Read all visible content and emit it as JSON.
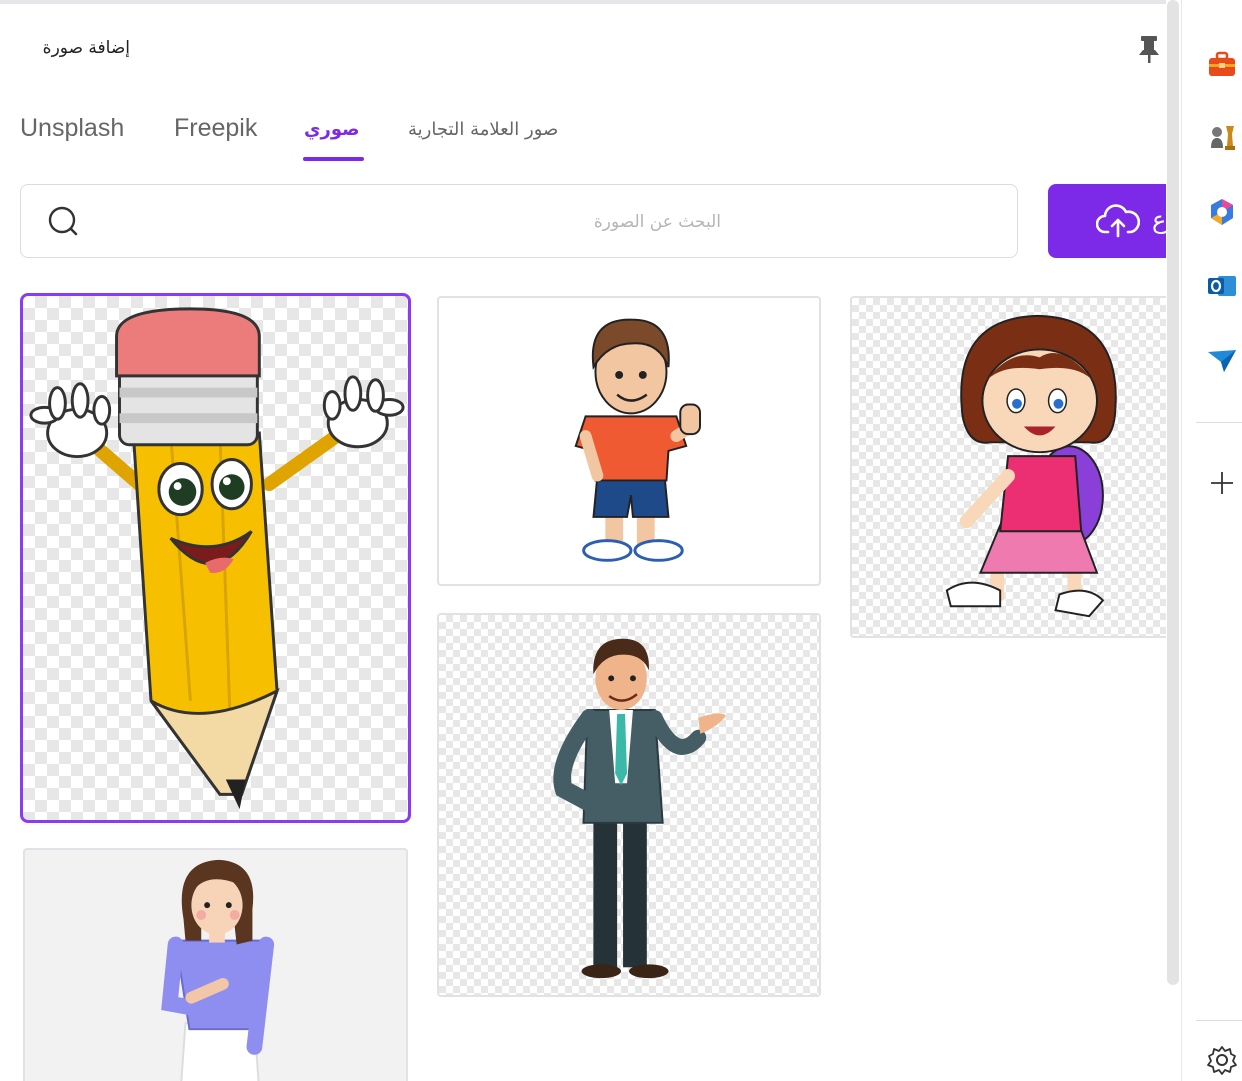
{
  "panel": {
    "title": "إضافة صورة"
  },
  "tabs": [
    {
      "label": "Unsplash"
    },
    {
      "label": "Freepik"
    },
    {
      "label": "صوري",
      "active": true
    },
    {
      "label": "صور العلامة التجارية"
    }
  ],
  "search": {
    "placeholder": "البحث عن الصورة"
  },
  "upload": {
    "label": "ع"
  },
  "gallery": {
    "items": [
      {
        "name": "pencil-cartoon",
        "selected": true
      },
      {
        "name": "boy-thumbs-up"
      },
      {
        "name": "girl-backpack"
      },
      {
        "name": "businessman"
      },
      {
        "name": "girl-purple-shirt"
      }
    ]
  },
  "rail": {
    "icons": [
      "briefcase-icon",
      "chess-icon",
      "copilot-icon",
      "outlook-icon",
      "send-icon",
      "add-icon",
      "settings-icon"
    ]
  },
  "colors": {
    "accent": "#7d2ae8"
  }
}
